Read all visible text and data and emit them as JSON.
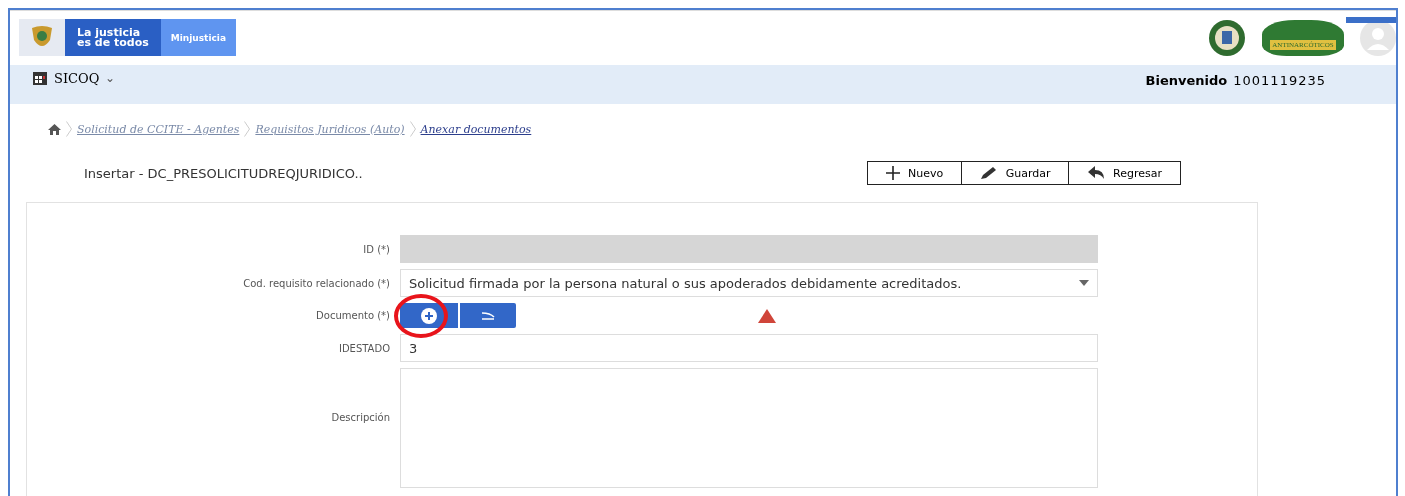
{
  "header": {
    "gov_logo_text": [
      "La justicia",
      "es de todos"
    ],
    "ministry": "Minjusticia",
    "unit_logo_text": "ANTINARCÓTICOS"
  },
  "nav": {
    "app": "SICOQ",
    "caret": "⌄",
    "welcome": "Bienvenido",
    "user": "1001119235"
  },
  "breadcrumbs": [
    {
      "label": "Solicitud de CCITE - Agentes",
      "selected": false
    },
    {
      "label": "Requisitos Juridicos (Auto)",
      "selected": false
    },
    {
      "label": "Anexar documentos",
      "selected": true
    }
  ],
  "title": "Insertar - DC_PRESOLICITUDREQJURIDICO..",
  "toolbar": [
    {
      "label": "Nuevo",
      "kind": "plus"
    },
    {
      "label": "Guardar",
      "kind": "pencil"
    },
    {
      "label": "Regresar",
      "kind": "back"
    }
  ],
  "form": [
    {
      "label": "ID (*)",
      "kind": "readonly"
    },
    {
      "label": "Cod. requisito relacionado (*)",
      "kind": "select",
      "value": "Solicitud firmada por la persona natural o sus apoderados debidamente acreditados."
    },
    {
      "label": "Documento (*)",
      "kind": "file",
      "highlighted": true,
      "warning": true
    },
    {
      "label": "IDESTADO",
      "kind": "text",
      "value": "3"
    },
    {
      "label": "Descripción",
      "kind": "textarea"
    }
  ]
}
